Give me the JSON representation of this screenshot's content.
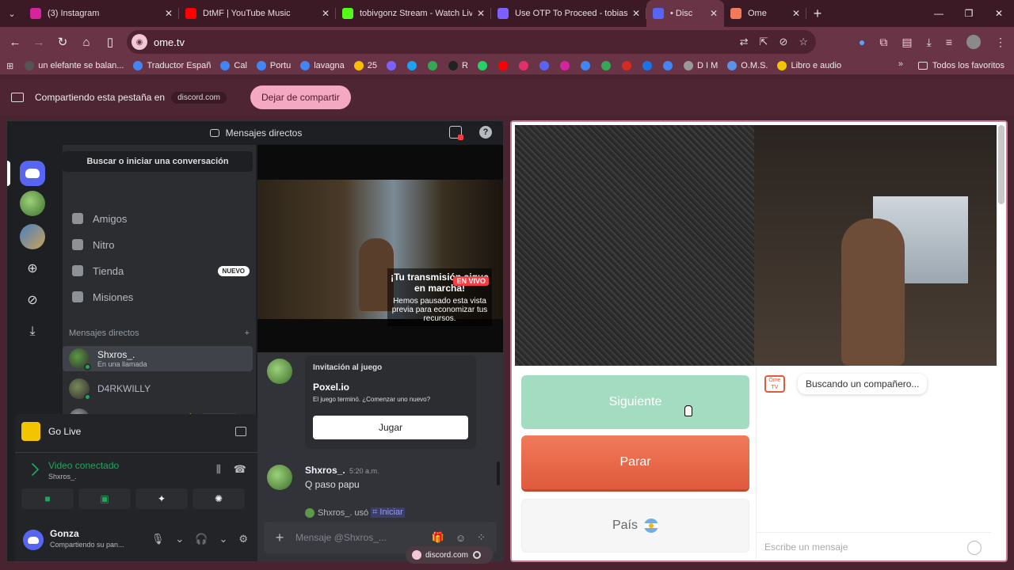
{
  "browser": {
    "tabs": [
      {
        "title": "(3) Instagram",
        "color": "#d6249f"
      },
      {
        "title": "DtMF | YouTube Music",
        "color": "#ff0000"
      },
      {
        "title": "tobivgonz Stream - Watch Live",
        "color": "#53fc18"
      },
      {
        "title": "Use OTP To Proceed - tobiasva",
        "color": "#7b61ff"
      },
      {
        "title": "• Disc",
        "color": "#5865f2"
      },
      {
        "title": "Ome",
        "color": "#f07a5a"
      }
    ],
    "url": "ome.tv",
    "bookmarks": [
      {
        "label": "un elefante se balan...",
        "color": "#555"
      },
      {
        "label": "Traductor Españ",
        "color": "#4285f4"
      },
      {
        "label": "Cal",
        "color": "#4285f4"
      },
      {
        "label": "Portu",
        "color": "#4285f4"
      },
      {
        "label": "lavagna",
        "color": "#4285f4"
      },
      {
        "label": "25",
        "color": "#fbbc04"
      },
      {
        "label": "",
        "color": "#7b61ff"
      },
      {
        "label": "",
        "color": "#1da1f2"
      },
      {
        "label": "",
        "color": "#34a853"
      },
      {
        "label": "R",
        "color": "#222"
      },
      {
        "label": "",
        "color": "#25d366"
      },
      {
        "label": "",
        "color": "#ff0000"
      },
      {
        "label": "",
        "color": "#e1306c"
      },
      {
        "label": "",
        "color": "#5865f2"
      },
      {
        "label": "",
        "color": "#d6249f"
      },
      {
        "label": "",
        "color": "#4285f4"
      },
      {
        "label": "",
        "color": "#34a853"
      },
      {
        "label": "",
        "color": "#d52b1e"
      },
      {
        "label": "",
        "color": "#1a73e8"
      },
      {
        "label": "",
        "color": "#4285f4"
      },
      {
        "label": "D I M",
        "color": "#999"
      },
      {
        "label": "O.M.S.",
        "color": "#5b92e5"
      },
      {
        "label": "Libro e audio",
        "color": "#f5c400"
      }
    ],
    "all_bookmarks": "Todos los favoritos",
    "more": "»"
  },
  "share_bar": {
    "text": "Compartiendo esta pestaña en",
    "domain": "discord.com",
    "stop_label": "Dejar de compartir"
  },
  "discord": {
    "title": "Mensajes directos",
    "search": "Buscar o iniciar una conversación",
    "nav": [
      {
        "label": "Amigos"
      },
      {
        "label": "Nitro"
      },
      {
        "label": "Tienda",
        "badge": "NUEVO"
      },
      {
        "label": "Misiones"
      }
    ],
    "dm_header": "Mensajes directos",
    "dm_add": "+",
    "dms": [
      {
        "name": "Shxros_.",
        "sub": "En una llamada",
        "color": "#5c9a45"
      },
      {
        "name": "D4RKWILLY",
        "sub": "",
        "color": "#7a8a5a"
      },
      {
        "name": "ꕥ 𝗘𝗻𝗱𝗲𝗿𝗯𝗹𝗮𝘇𝗲𝗬𝗧 🎄",
        "sub": "",
        "color": "#9aa0a6",
        "tag": "💗たおし"
      }
    ],
    "golive": "Go Live",
    "voice_status": "Video conectado",
    "voice_user": "Shxros_.",
    "user_name": "Gonza",
    "user_sub": "Compartiendo su pan...",
    "stream_overlay_title": "¡Tu transmisión sigue en marcha!",
    "stream_overlay_text": "Hemos pausado esta vista previa para economizar tus recursos.",
    "live_tag": "EN VIVO",
    "invite": {
      "label": "Invitación al juego",
      "title": "Poxel.io",
      "desc": "El juego terminó. ¿Comenzar uno nuevo?",
      "button": "Jugar"
    },
    "message": {
      "author": "Shxros_.",
      "time": "5:20 a.m.",
      "text": "Q paso papu"
    },
    "system": {
      "user": "Shxros_.",
      "verb": "usó",
      "command": "⌗ Iniciar"
    },
    "composer_placeholder": "Mensaje @Shxros_..."
  },
  "tab_pill": "discord.com",
  "ome": {
    "next": "Siguiente",
    "stop": "Parar",
    "country": "País",
    "logo": "Ome TV",
    "status": "Buscando un compañero...",
    "input_placeholder": "Escribe un mensaje"
  }
}
